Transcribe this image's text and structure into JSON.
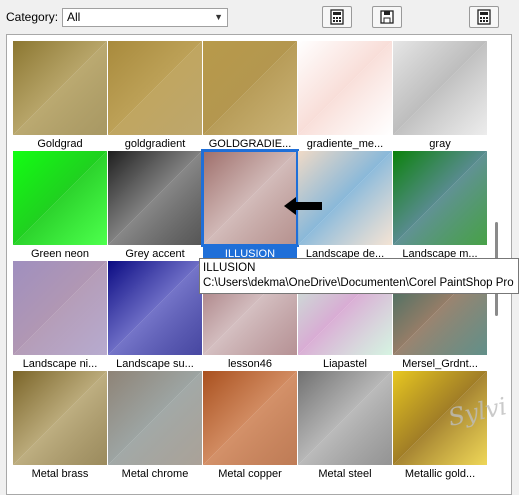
{
  "category": {
    "label": "Category:",
    "selected": "All"
  },
  "toolbar": [
    {
      "name": "view-list-button",
      "icon": "calculator-icon"
    },
    {
      "name": "open-folder-button",
      "icon": "save-disk-icon"
    },
    {
      "name": "resource-manager-button",
      "icon": "calculator-icon"
    }
  ],
  "gradients": [
    {
      "name": "Goldgrad",
      "c1": "#8b7630",
      "c2": "#d8c58a"
    },
    {
      "name": "goldgradient",
      "c1": "#a88a3c",
      "c2": "#c7a958"
    },
    {
      "name": "GOLDGRADIE...",
      "c1": "#b89a4a",
      "c2": "#a38338"
    },
    {
      "name": "gradiente_me...",
      "c1": "#ffffff",
      "c2": "#f1b7ab"
    },
    {
      "name": "gray",
      "c1": "#e6e6e6",
      "c2": "#8a8a8a"
    },
    {
      "name": "Green neon",
      "c1": "#12ff12",
      "c2": "#0a9a0a"
    },
    {
      "name": "Grey accent",
      "c1": "#1e1e1e",
      "c2": "#cfcfcf"
    },
    {
      "name": "ILLUSION",
      "c1": "#9e6e6a",
      "c2": "#fbf6f6"
    },
    {
      "name": "Landscape de...",
      "c1": "#f0dac6",
      "c2": "#0f8be6"
    },
    {
      "name": "Landscape m...",
      "c1": "#0b820b",
      "c2": "#8a82ff"
    },
    {
      "name": "Landscape ni...",
      "c1": "#9f8fbf",
      "c2": "#b68f9c"
    },
    {
      "name": "Landscape su...",
      "c1": "#0a0a82",
      "c2": "#b8b8ff"
    },
    {
      "name": "lesson46",
      "c1": "#9e6e72",
      "c2": "#ffffff"
    },
    {
      "name": "Liapastel",
      "c1": "#c8f0d8",
      "c2": "#e25ac8"
    },
    {
      "name": "Mersel_Grdnt...",
      "c1": "#2e6b62",
      "c2": "#ea7a55"
    },
    {
      "name": "Metal brass",
      "c1": "#7a6428",
      "c2": "#efe2b6"
    },
    {
      "name": "Metal chrome",
      "c1": "#8e8376",
      "c2": "#9cb7c0"
    },
    {
      "name": "Metal copper",
      "c1": "#a9501e",
      "c2": "#f2b38a"
    },
    {
      "name": "Metal steel",
      "c1": "#707070",
      "c2": "#f2f2f2"
    },
    {
      "name": "Metallic gold...",
      "c1": "#e8c820",
      "c2": "#4a1e0a"
    }
  ],
  "selected_index": 7,
  "tooltip": {
    "title": "ILLUSION",
    "path": "C:\\Users\\dekma\\OneDrive\\Documenten\\Corel PaintShop Pro"
  },
  "watermark": "Sylvi",
  "colors": {
    "selection": "#1f6fd8"
  }
}
